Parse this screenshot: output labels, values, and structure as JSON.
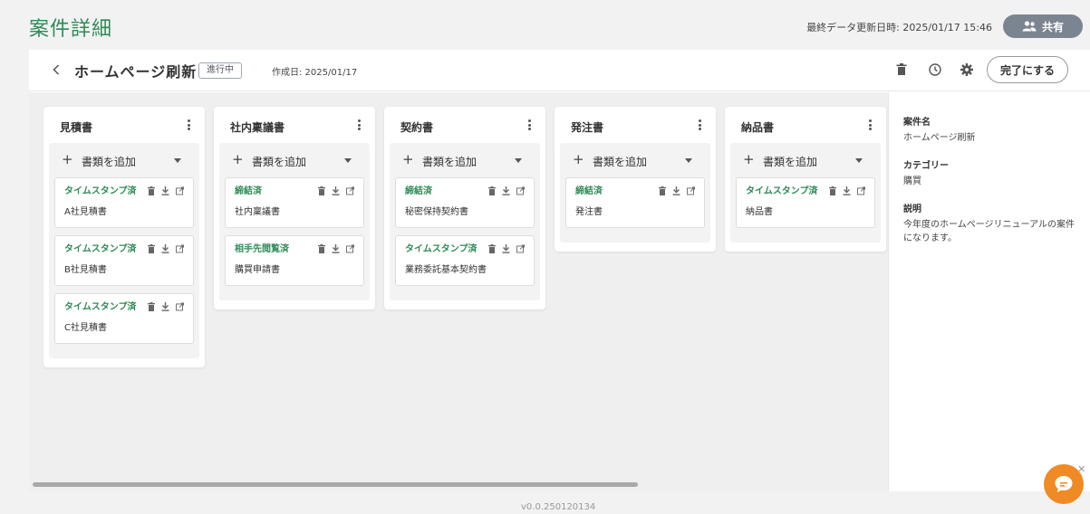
{
  "header": {
    "title": "案件詳細",
    "updated_text": "最終データ更新日時: 2025/01/17 15:46",
    "share_label": "共有"
  },
  "topbar": {
    "project_title": "ホームページ刷新",
    "status": "進行中",
    "created": "作成日: 2025/01/17",
    "complete_label": "完了にする"
  },
  "columns": [
    {
      "title": "見積書",
      "add_label": "書類を追加",
      "cards": [
        {
          "status": "タイムスタンプ済",
          "name": "A社見積書"
        },
        {
          "status": "タイムスタンプ済",
          "name": "B社見積書"
        },
        {
          "status": "タイムスタンプ済",
          "name": "C社見積書"
        }
      ]
    },
    {
      "title": "社内稟議書",
      "add_label": "書類を追加",
      "cards": [
        {
          "status": "締結済",
          "name": "社内稟議書"
        },
        {
          "status": "相手先閲覧済",
          "name": "購買申請書"
        }
      ]
    },
    {
      "title": "契約書",
      "add_label": "書類を追加",
      "cards": [
        {
          "status": "締結済",
          "name": "秘密保持契約書"
        },
        {
          "status": "タイムスタンプ済",
          "name": "業務委託基本契約書"
        }
      ]
    },
    {
      "title": "発注書",
      "add_label": "書類を追加",
      "cards": [
        {
          "status": "締結済",
          "name": "発注書"
        }
      ]
    },
    {
      "title": "納品書",
      "add_label": "書類を追加",
      "cards": [
        {
          "status": "タイムスタンプ済",
          "name": "納品書"
        }
      ]
    }
  ],
  "info": {
    "name_label": "案件名",
    "name_value": "ホームページ刷新",
    "category_label": "カテゴリー",
    "category_value": "購買",
    "desc_label": "説明",
    "desc_value": "今年度のホームページリニューアルの案件になります。"
  },
  "footer": {
    "version": "v0.0.250120134"
  },
  "colors": {
    "accent": "#2e8b57",
    "share_bg": "#7b8591",
    "fab": "#f08a24"
  }
}
